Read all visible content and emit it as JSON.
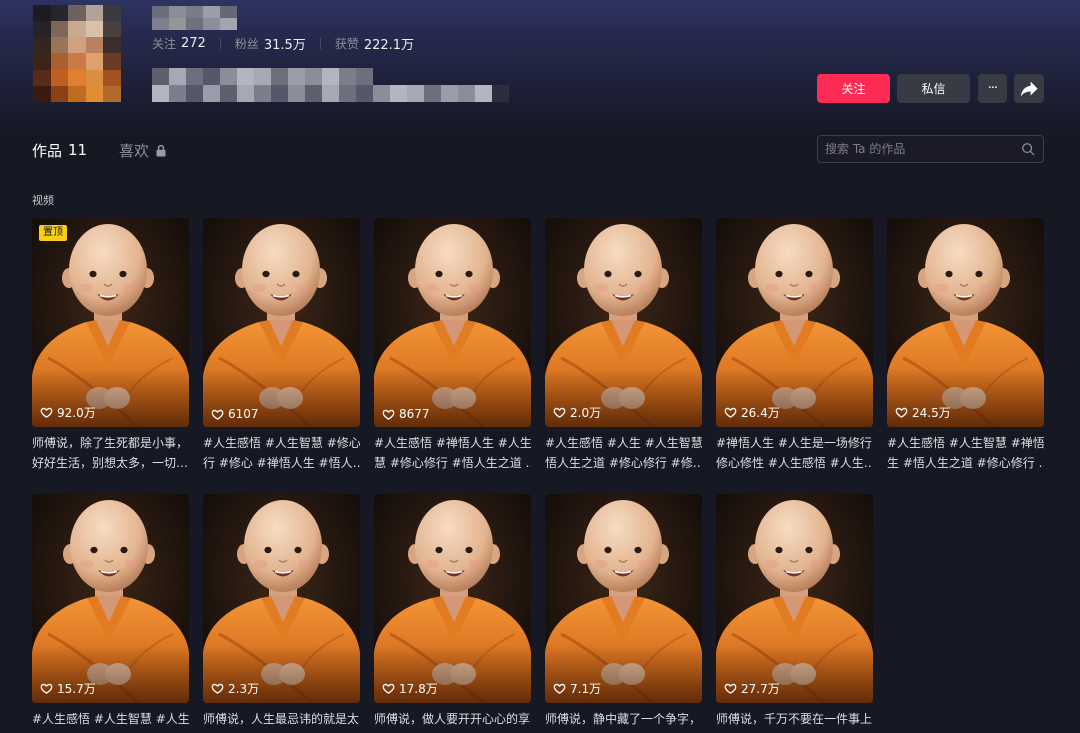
{
  "profile": {
    "stats": [
      {
        "label": "关注",
        "value": "272"
      },
      {
        "label": "粉丝",
        "value": "31.5万"
      },
      {
        "label": "获赞",
        "value": "222.1万"
      }
    ]
  },
  "actions": {
    "follow_label": "关注",
    "message_label": "私信",
    "more_label": "···"
  },
  "tabs": [
    {
      "label": "作品",
      "count": "11",
      "active": true
    },
    {
      "label": "喜欢",
      "locked": true,
      "active": false
    }
  ],
  "search": {
    "placeholder": "搜索 Ta 的作品"
  },
  "section_label": "视频",
  "videos": [
    {
      "pinned_badge": "置顶",
      "likes": "92.0万",
      "caption_lines": [
        "师傅说，除了生死都是小事，",
        "好好生活，别想太多，一切…"
      ]
    },
    {
      "likes": "6107",
      "caption_lines": [
        "#人生感悟 #人生智慧 #修心修",
        "行 #修心 #禅悟人生 #悟人…"
      ]
    },
    {
      "likes": "8677",
      "caption_lines": [
        "#人生感悟 #禅悟人生 #人生智",
        "慧 #修心修行 #悟人生之道 …"
      ]
    },
    {
      "likes": "2.0万",
      "caption_lines": [
        "#人生感悟 #人生 #人生智慧 #",
        "悟人生之道 #修心修行 #修…"
      ]
    },
    {
      "likes": "26.4万",
      "caption_lines": [
        "#禅悟人生 #人生是一场修行 #",
        "修心修性 #人生感悟 #人生…"
      ]
    },
    {
      "likes": "24.5万",
      "caption_lines": [
        "#人生感悟 #人生智慧 #禅悟人",
        "生 #悟人生之道 #修心修行 …"
      ]
    },
    {
      "likes": "15.7万",
      "caption_lines": [
        "#人生感悟 #人生智慧 #人生 #"
      ]
    },
    {
      "likes": "2.3万",
      "caption_lines": [
        "师傅说，人生最忌讳的就是太"
      ]
    },
    {
      "likes": "17.8万",
      "caption_lines": [
        "师傅说，做人要开开心心的享"
      ]
    },
    {
      "likes": "7.1万",
      "caption_lines": [
        "师傅说，静中藏了一个争字，"
      ]
    },
    {
      "likes": "27.7万",
      "caption_lines": [
        "师傅说，千万不要在一件事上"
      ]
    }
  ],
  "colors": {
    "background": "#161823",
    "accent": "#fe2c55",
    "pinned_badge": "#face15",
    "secondary_button": "#393b44"
  },
  "icons": {
    "like": "heart-icon",
    "lock": "lock-icon",
    "search": "search-icon",
    "share": "share-icon",
    "more": "more-icon"
  }
}
